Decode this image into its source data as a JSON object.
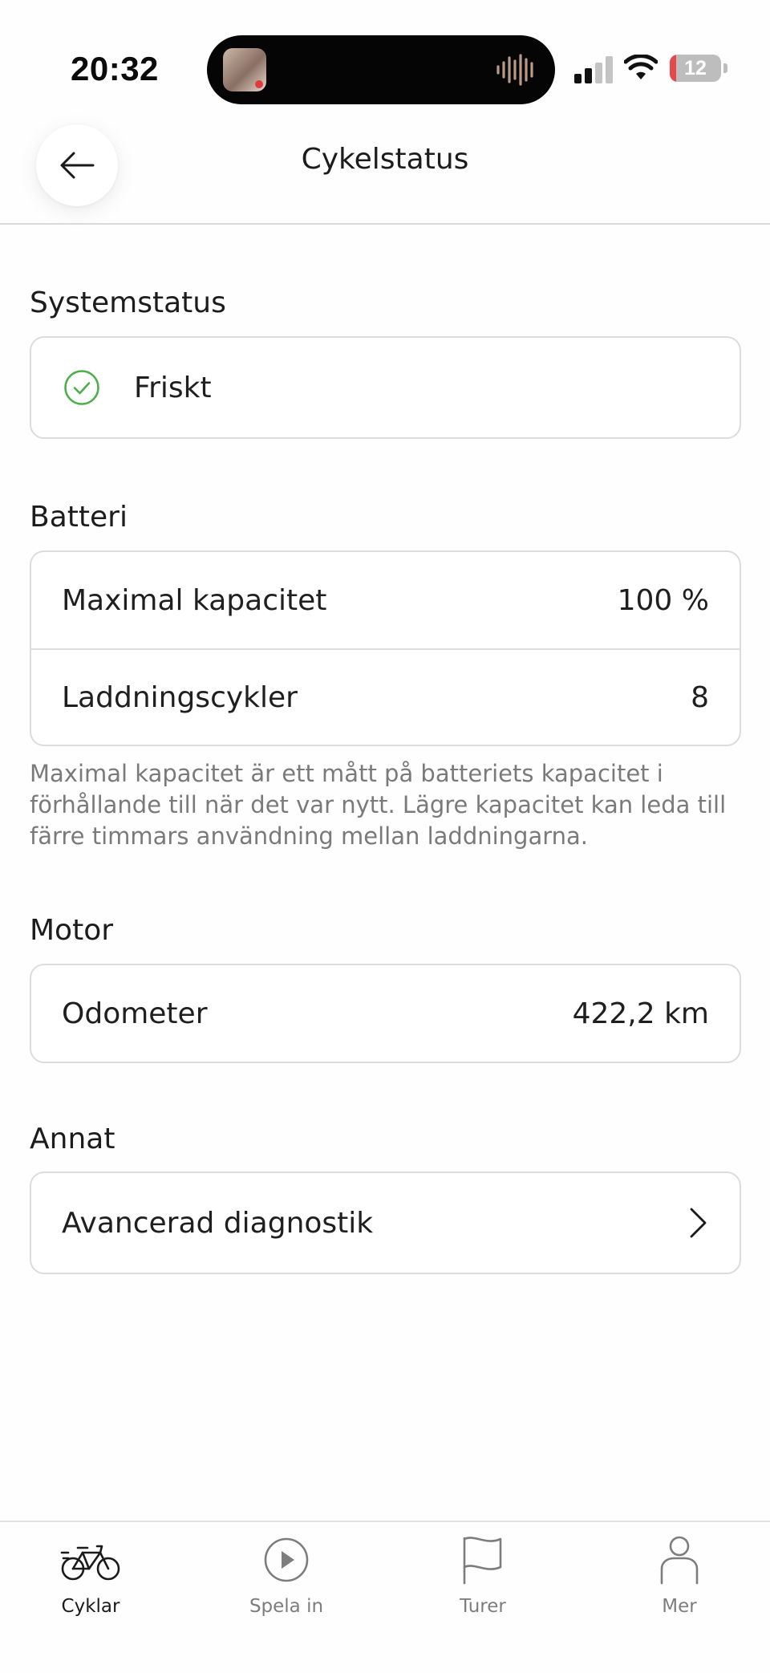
{
  "status_bar": {
    "time": "20:32",
    "battery_level": "12",
    "battery_color": "#e5484d"
  },
  "header": {
    "title": "Cykelstatus",
    "back_icon": "arrow-left-icon"
  },
  "system_status": {
    "title": "Systemstatus",
    "value": "Friskt",
    "icon": "check-circle-icon",
    "icon_color": "#4cae4c"
  },
  "battery": {
    "title": "Batteri",
    "rows": [
      {
        "label": "Maximal kapacitet",
        "value": "100 %"
      },
      {
        "label": "Laddningscykler",
        "value": "8"
      }
    ],
    "note": "Maximal kapacitet är ett mått på batteriets kapacitet i förhållande till när det var nytt. Lägre kapacitet kan leda till färre timmars användning mellan laddningarna."
  },
  "motor": {
    "title": "Motor",
    "rows": [
      {
        "label": "Odometer",
        "value": "422,2 km"
      }
    ]
  },
  "other": {
    "title": "Annat",
    "rows": [
      {
        "label": "Avancerad diagnostik",
        "icon": "chevron-right-icon"
      }
    ]
  },
  "tab_bar": {
    "tabs": [
      {
        "label": "Cyklar",
        "icon": "bike-icon",
        "active": true
      },
      {
        "label": "Spela in",
        "icon": "play-circle-icon",
        "active": false
      },
      {
        "label": "Turer",
        "icon": "flag-icon",
        "active": false
      },
      {
        "label": "Mer",
        "icon": "person-icon",
        "active": false
      }
    ]
  }
}
